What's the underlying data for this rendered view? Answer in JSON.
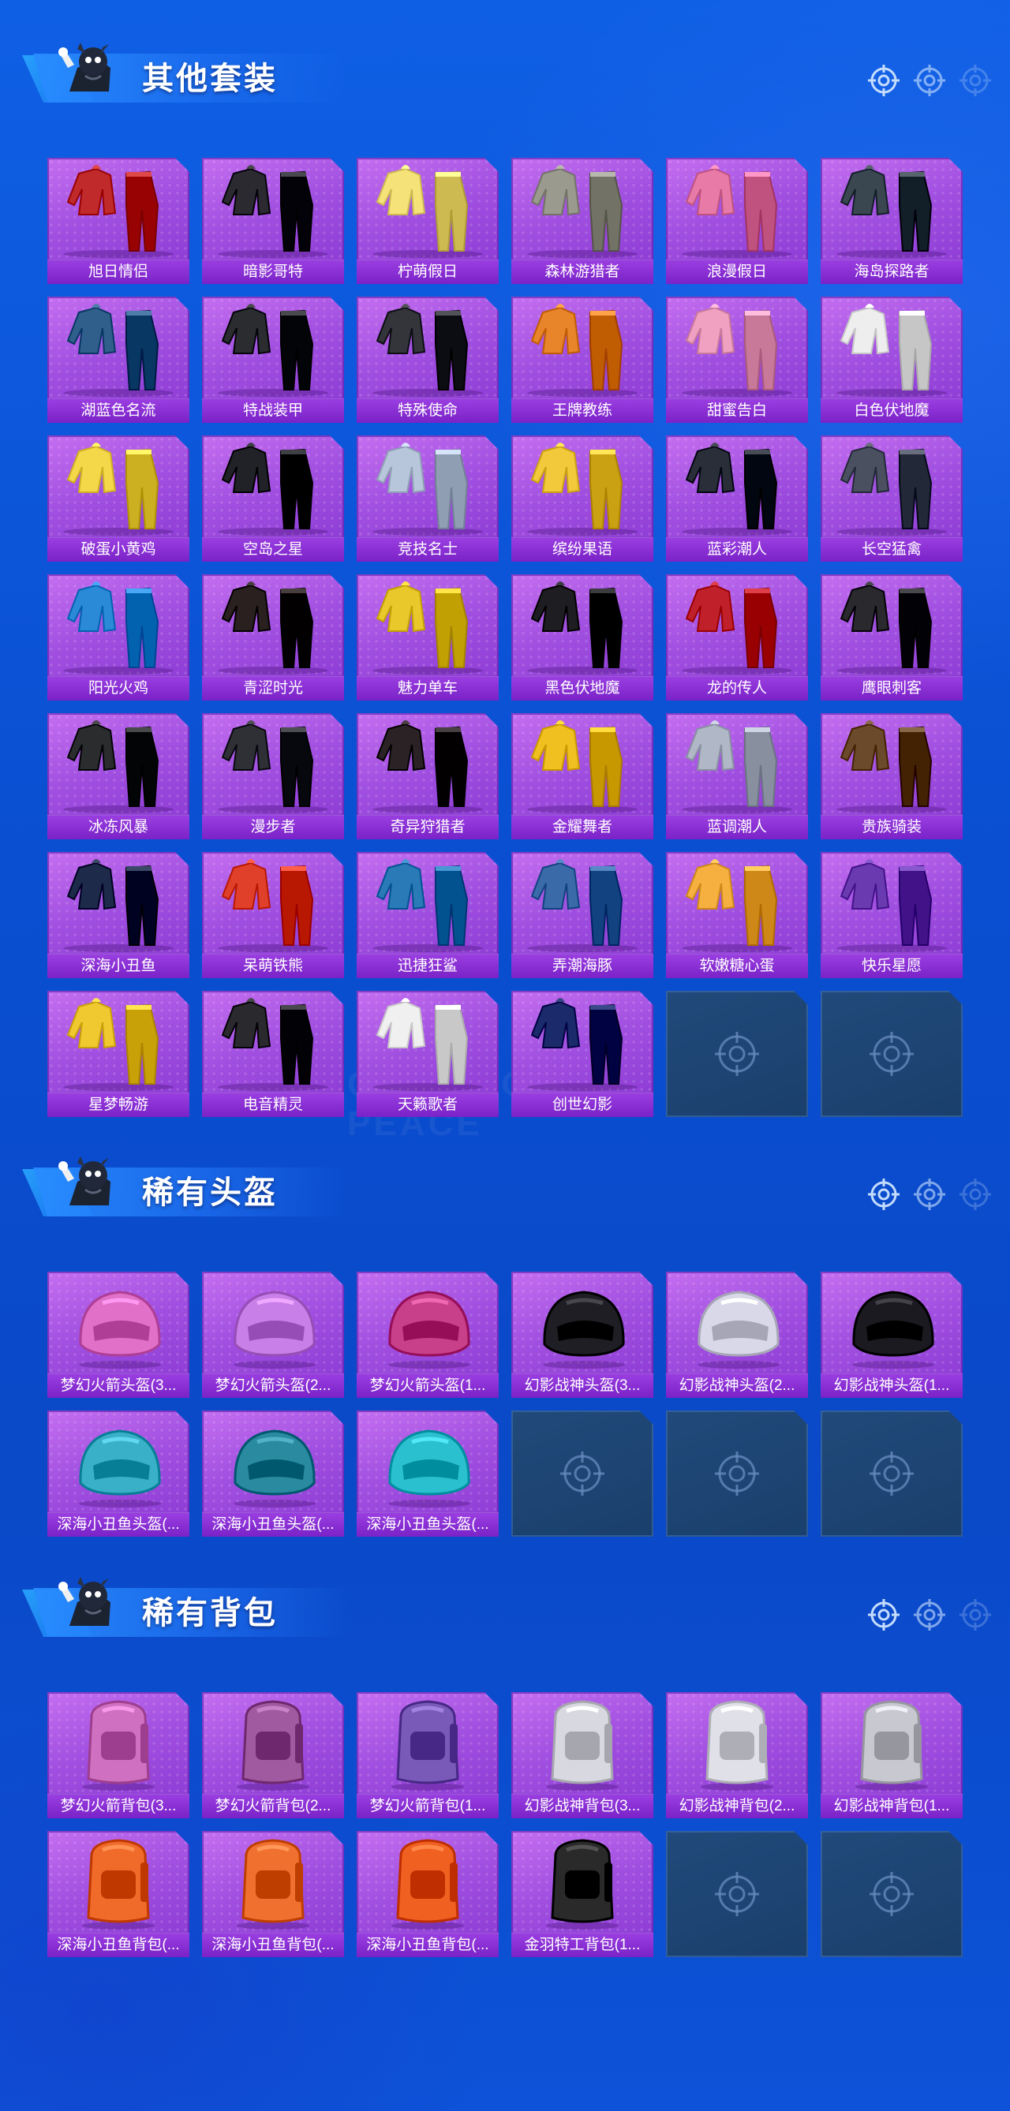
{
  "sections": [
    {
      "title": "其他套装",
      "kind": "outfit",
      "items": [
        {
          "label": "旭日情侣",
          "color": "#c02a2a"
        },
        {
          "label": "暗影哥特",
          "color": "#2a2a30"
        },
        {
          "label": "柠萌假日",
          "color": "#f5e37a"
        },
        {
          "label": "森林游猎者",
          "color": "#9a9a8e"
        },
        {
          "label": "浪漫假日",
          "color": "#e87aa8"
        },
        {
          "label": "海岛探路者",
          "color": "#3a4650"
        },
        {
          "label": "湖蓝色名流",
          "color": "#2f5f8a"
        },
        {
          "label": "特战装甲",
          "color": "#2a2c30"
        },
        {
          "label": "特殊使命",
          "color": "#33353a"
        },
        {
          "label": "王牌教练",
          "color": "#e8842a"
        },
        {
          "label": "甜蜜告白",
          "color": "#f0a0c0"
        },
        {
          "label": "白色伏地魔",
          "color": "#eeeeee"
        },
        {
          "label": "破蛋小黄鸡",
          "color": "#f5d84a"
        },
        {
          "label": "空岛之星",
          "color": "#202228"
        },
        {
          "label": "竞技名士",
          "color": "#b8c6dc"
        },
        {
          "label": "缤纷果语",
          "color": "#f2c93a"
        },
        {
          "label": "蓝彩潮人",
          "color": "#2a2e38"
        },
        {
          "label": "长空猛禽",
          "color": "#4a5060"
        },
        {
          "label": "阳光火鸡",
          "color": "#2a8ad8"
        },
        {
          "label": "青涩时光",
          "color": "#2a2020"
        },
        {
          "label": "魅力单车",
          "color": "#e8c82a"
        },
        {
          "label": "黑色伏地魔",
          "color": "#1e1e22"
        },
        {
          "label": "龙的传人",
          "color": "#c0202a"
        },
        {
          "label": "鹰眼刺客",
          "color": "#2a2a2e"
        },
        {
          "label": "冰冻风暴",
          "color": "#2a2c2e"
        },
        {
          "label": "漫步者",
          "color": "#2e3036"
        },
        {
          "label": "奇异狩猎者",
          "color": "#2a2224"
        },
        {
          "label": "金耀舞者",
          "color": "#f0c020"
        },
        {
          "label": "蓝调潮人",
          "color": "#b0b8c8"
        },
        {
          "label": "贵族骑装",
          "color": "#6a4a2a"
        },
        {
          "label": "深海小丑鱼",
          "color": "#1e2a4a"
        },
        {
          "label": "呆萌铁熊",
          "color": "#e0402a"
        },
        {
          "label": "迅捷狂鲨",
          "color": "#2a7ab8"
        },
        {
          "label": "弄潮海豚",
          "color": "#3a6aa8"
        },
        {
          "label": "软嫩糖心蛋",
          "color": "#f5b040"
        },
        {
          "label": "快乐星愿",
          "color": "#6a3ab0"
        },
        {
          "label": "星梦畅游",
          "color": "#f0c830"
        },
        {
          "label": "电音精灵",
          "color": "#2a2a2e"
        },
        {
          "label": "天籁歌者",
          "color": "#f0f0f0"
        },
        {
          "label": "创世幻影",
          "color": "#1a2a6a"
        }
      ],
      "empty_slots": 2
    },
    {
      "title": "稀有头盔",
      "kind": "helmet",
      "items": [
        {
          "label": "梦幻火箭头盔(3...",
          "color": "#e070c8"
        },
        {
          "label": "梦幻火箭头盔(2...",
          "color": "#c880e8"
        },
        {
          "label": "梦幻火箭头盔(1...",
          "color": "#c8408a"
        },
        {
          "label": "幻影战神头盔(3...",
          "color": "#1e1e24"
        },
        {
          "label": "幻影战神头盔(2...",
          "color": "#d8d8e8"
        },
        {
          "label": "幻影战神头盔(1...",
          "color": "#1a1a20"
        },
        {
          "label": "深海小丑鱼头盔(...",
          "color": "#3ab0c8"
        },
        {
          "label": "深海小丑鱼头盔(...",
          "color": "#2a8aa0"
        },
        {
          "label": "深海小丑鱼头盔(...",
          "color": "#2ac0d0"
        }
      ],
      "empty_slots": 3
    },
    {
      "title": "稀有背包",
      "kind": "backpack",
      "items": [
        {
          "label": "梦幻火箭背包(3...",
          "color": "#d070c0"
        },
        {
          "label": "梦幻火箭背包(2...",
          "color": "#a05aa0"
        },
        {
          "label": "梦幻火箭背包(1...",
          "color": "#7a5ab8"
        },
        {
          "label": "幻影战神背包(3...",
          "color": "#d8d8e0"
        },
        {
          "label": "幻影战神背包(2...",
          "color": "#e0e0e8"
        },
        {
          "label": "幻影战神背包(1...",
          "color": "#c8c8d0"
        },
        {
          "label": "深海小丑鱼背包(...",
          "color": "#f06a2a"
        },
        {
          "label": "深海小丑鱼背包(...",
          "color": "#f07030"
        },
        {
          "label": "深海小丑鱼背包(...",
          "color": "#f06020"
        },
        {
          "label": "金羽特工背包(1...",
          "color": "#2a2a2a"
        }
      ],
      "empty_slots": 2
    }
  ],
  "watermark": "GAME FOR PEACE",
  "accent": "#0a4fd2",
  "card_color": "#a04fe0",
  "empty_card_color": "#1f4676"
}
